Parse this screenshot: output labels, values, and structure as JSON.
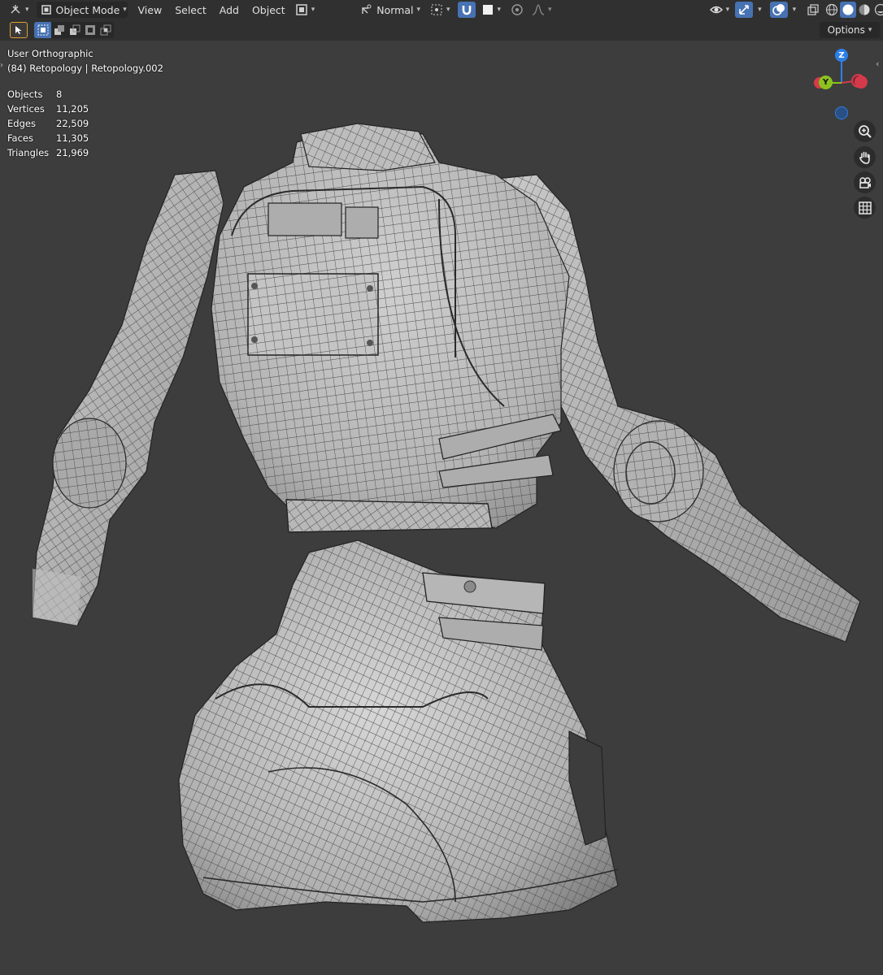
{
  "header": {
    "mode_label": "Object Mode",
    "menus": [
      "View",
      "Select",
      "Add",
      "Object"
    ],
    "transform_orientation": "Normal"
  },
  "toolbar": {
    "options_label": "Options"
  },
  "viewport": {
    "view_name": "User Orthographic",
    "collection_info": "(84) Retopology | Retopology.002",
    "stats": [
      {
        "label": "Objects",
        "value": "8"
      },
      {
        "label": "Vertices",
        "value": "11,205"
      },
      {
        "label": "Edges",
        "value": "22,509"
      },
      {
        "label": "Faces",
        "value": "11,305"
      },
      {
        "label": "Triangles",
        "value": "21,969"
      }
    ],
    "gizmo": {
      "z_label": "Z",
      "y_label": "Y"
    }
  },
  "colors": {
    "header_bg": "#303030",
    "viewport_bg": "#3d3d3d",
    "active_blue": "#4772b3",
    "mesh_fill": "#bdbdbd",
    "wire": "#4a4a4a",
    "axis_x": "#d53a4b",
    "axis_y": "#8cc21d",
    "axis_z": "#2c80ea"
  }
}
